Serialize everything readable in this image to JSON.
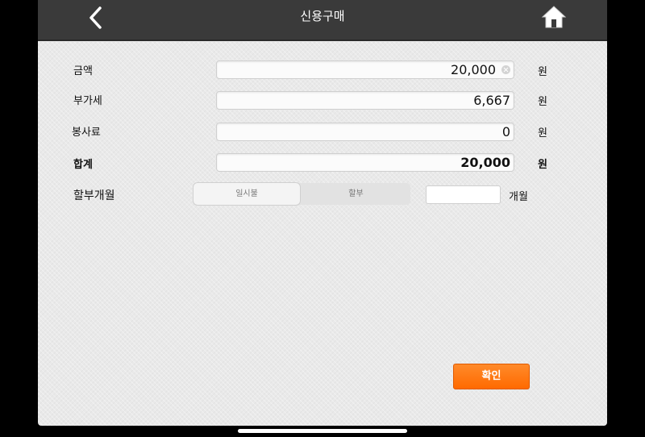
{
  "header": {
    "title": "신용구매",
    "back_icon": "chevron-left-icon",
    "home_icon": "home-icon"
  },
  "form": {
    "amount": {
      "label": "금액",
      "value": "20,000",
      "unit": "원"
    },
    "vat": {
      "label": "부가세",
      "value": "6,667",
      "unit": "원"
    },
    "service_fee": {
      "label": "봉사료",
      "value": "0",
      "unit": "원"
    },
    "total": {
      "label": "합계",
      "value": "20,000",
      "unit": "원"
    },
    "installment": {
      "label": "할부개월",
      "options": [
        "일시불",
        "할부"
      ],
      "selected": "일시불",
      "months_value": "",
      "months_unit": "개월"
    }
  },
  "confirm_label": "확인",
  "colors": {
    "header_bg": "#3a3a3a",
    "accent": "#ff7a10",
    "page_bg": "#e9e9e9"
  }
}
